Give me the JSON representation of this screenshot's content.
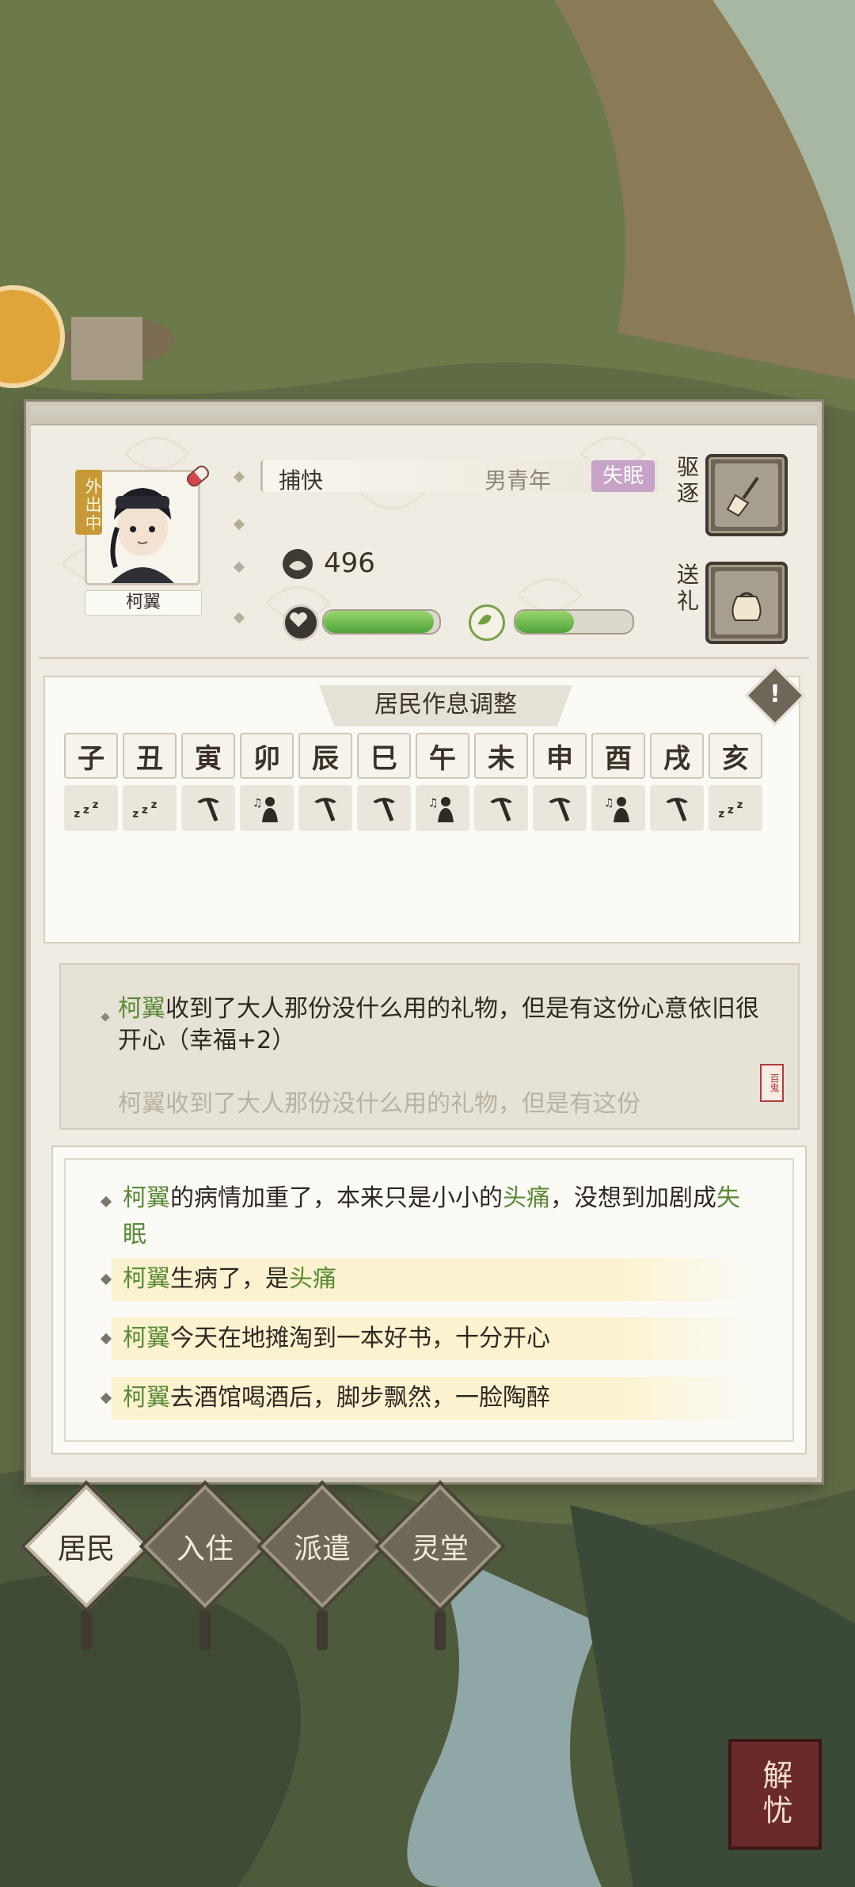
{
  "resident": {
    "status_tag": "外出中",
    "name": "柯翼",
    "role": "捕快",
    "traits": "男青年",
    "condition": "失眠",
    "coins": "496",
    "health_fraction": 0.95,
    "mood_fraction": 0.5
  },
  "actions": {
    "expel_label": "驱逐",
    "gift_label": "送礼"
  },
  "schedule": {
    "title": "居民作息调整",
    "hours": [
      "子",
      "丑",
      "寅",
      "卯",
      "辰",
      "巳",
      "午",
      "未",
      "申",
      "酉",
      "戌",
      "亥"
    ],
    "activities": [
      "sleep",
      "sleep",
      "work",
      "leisure",
      "work",
      "work",
      "leisure",
      "work",
      "work",
      "leisure",
      "work",
      "sleep"
    ]
  },
  "gift_log": {
    "text_name": "柯翼",
    "text_body": "收到了大人那份没什么用的礼物，但是有这份心意依旧很开心（幸福+2）",
    "text_faded": "柯翼收到了大人那份没什么用的礼物，但是有这份",
    "seal": "百鬼"
  },
  "event_log": [
    {
      "name": "柯翼",
      "parts": [
        "的病情加重了，本来只是小小的",
        "头痛",
        "，没想到加剧成",
        "失眠"
      ],
      "highlight": false
    },
    {
      "name": "柯翼",
      "parts": [
        "生病了，是",
        "头痛"
      ],
      "highlight": true
    },
    {
      "name": "柯翼",
      "parts": [
        "今天在地摊淘到一本好书，十分开心"
      ],
      "highlight": true
    },
    {
      "name": "柯翼",
      "parts": [
        "去酒馆喝酒后，脚步飘然，一脸陶醉"
      ],
      "highlight": true
    }
  ],
  "tabs": [
    "居民",
    "入住",
    "派遣",
    "灵堂"
  ],
  "relieve_button": "解忧",
  "colors": {
    "highlight_green": "#5b8a36",
    "condition_purple": "#c6a3c7",
    "health_green": "#4fa43a"
  }
}
